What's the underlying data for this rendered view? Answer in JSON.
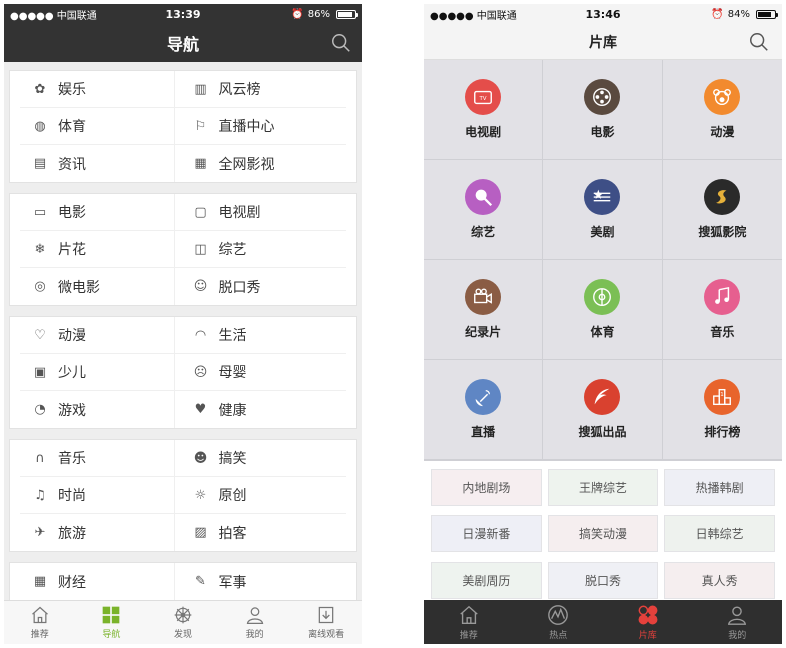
{
  "left": {
    "status": {
      "carrier": "●●●●● 中国联通",
      "time": "13:39",
      "battery": "86%",
      "battery_level": 0.86
    },
    "header": {
      "title": "导航"
    },
    "groups": [
      {
        "rows": [
          [
            "娱乐",
            "风云榜"
          ],
          [
            "体育",
            "直播中心"
          ],
          [
            "资讯",
            "全网影视"
          ]
        ]
      },
      {
        "rows": [
          [
            "电影",
            "电视剧"
          ],
          [
            "片花",
            "综艺"
          ],
          [
            "微电影",
            "脱口秀"
          ]
        ]
      },
      {
        "rows": [
          [
            "动漫",
            "生活"
          ],
          [
            "少儿",
            "母婴"
          ],
          [
            "游戏",
            "健康"
          ]
        ]
      },
      {
        "rows": [
          [
            "音乐",
            "搞笑"
          ],
          [
            "时尚",
            "原创"
          ],
          [
            "旅游",
            "拍客"
          ]
        ]
      },
      {
        "rows": [
          [
            "财经",
            "军事"
          ]
        ]
      }
    ],
    "tabbar": [
      {
        "label": "推荐",
        "icon": "home-icon"
      },
      {
        "label": "导航",
        "icon": "grid-icon"
      },
      {
        "label": "发现",
        "icon": "wheel-icon"
      },
      {
        "label": "我的",
        "icon": "user-icon"
      },
      {
        "label": "离线观看",
        "icon": "download-icon"
      }
    ]
  },
  "right": {
    "status": {
      "carrier": "●●●●● 中国联通",
      "time": "13:46",
      "battery": "84%",
      "battery_level": 0.84
    },
    "header": {
      "title": "片库"
    },
    "categories": [
      {
        "label": "电视剧",
        "color": "#e44d4a",
        "icon": "tv-icon"
      },
      {
        "label": "电影",
        "color": "#5a4a3f",
        "icon": "film-reel-icon"
      },
      {
        "label": "动漫",
        "color": "#f28a2e",
        "icon": "bear-icon"
      },
      {
        "label": "综艺",
        "color": "#b75fc2",
        "icon": "microphone-icon"
      },
      {
        "label": "美剧",
        "color": "#3e4f86",
        "icon": "flag-icon"
      },
      {
        "label": "搜狐影院",
        "color": "#2a2a2a",
        "icon": "sohu-cinema-icon"
      },
      {
        "label": "纪录片",
        "color": "#8a5c44",
        "icon": "camera-icon"
      },
      {
        "label": "体育",
        "color": "#7bbf55",
        "icon": "field-icon"
      },
      {
        "label": "音乐",
        "color": "#e65f8f",
        "icon": "music-note-icon"
      },
      {
        "label": "直播",
        "color": "#5f86c4",
        "icon": "satellite-icon"
      },
      {
        "label": "搜狐出品",
        "color": "#d9412f",
        "icon": "feather-icon"
      },
      {
        "label": "排行榜",
        "color": "#e8642c",
        "icon": "podium-icon"
      }
    ],
    "tags": [
      "内地剧场",
      "王牌综艺",
      "热播韩剧",
      "日漫新番",
      "搞笑动漫",
      "日韩综艺",
      "美剧周历",
      "脱口秀",
      "真人秀"
    ],
    "tabbar": [
      {
        "label": "推荐",
        "icon": "home-icon"
      },
      {
        "label": "热点",
        "icon": "hot-icon"
      },
      {
        "label": "片库",
        "icon": "library-icon"
      },
      {
        "label": "我的",
        "icon": "user-icon"
      }
    ]
  }
}
